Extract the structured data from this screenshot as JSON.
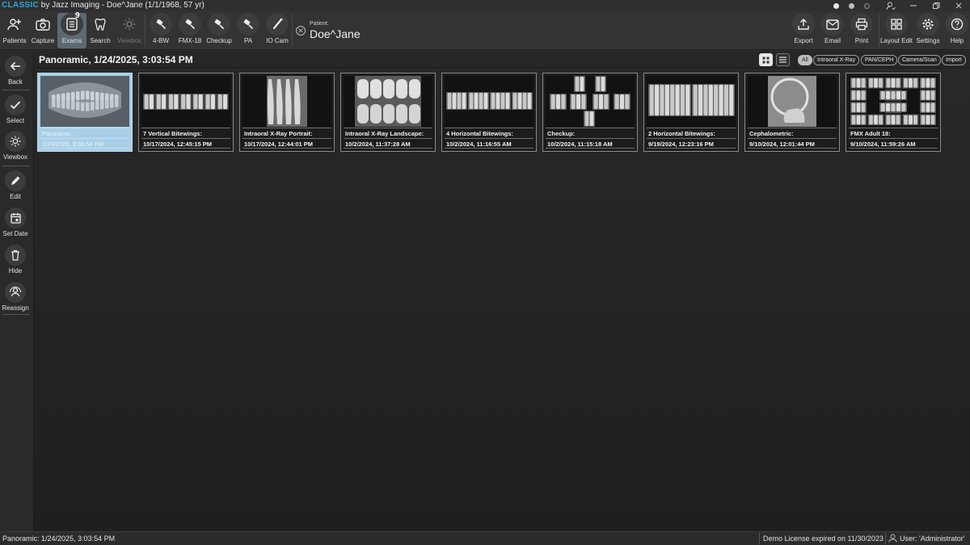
{
  "window": {
    "brand": "CLASSIC",
    "title_rest": " by Jazz Imaging - Doe^Jane (1/1/1968, 57 yr)"
  },
  "toolbar": {
    "patients": "Patients",
    "capture": "Capture",
    "exams": "Exams",
    "exams_badge": "9",
    "search": "Search",
    "viewbox": "Viewbox",
    "bw4": "4-BW",
    "fmx18": "FMX-18",
    "checkup": "Checkup",
    "pa": "PA",
    "iocam": "IO Cam",
    "export": "Export",
    "email": "Email",
    "print": "Print",
    "layout_edit": "Layout Edit",
    "settings": "Settings",
    "help": "Help"
  },
  "patient": {
    "label": "Patient:",
    "name": "Doe^Jane",
    "clear_glyph": "✕"
  },
  "sidebar": {
    "back": "Back",
    "select": "Select",
    "viewbox": "Viewbox",
    "edit": "Edit",
    "set_date": "Set Date",
    "hide": "Hide",
    "reassign": "Reassign"
  },
  "header": {
    "title": "Panoramic, 1/24/2025, 3:03:54 PM",
    "filters": [
      "All",
      "Intraoral X-Ray",
      "PAN/CEPH",
      "Camera/Scan",
      "Import"
    ]
  },
  "exams": [
    {
      "name": "Panoramic:",
      "date": "1/24/2025, 3:03:54 PM",
      "kind": "pan",
      "selected": true
    },
    {
      "name": "7 Vertical Bitewings:",
      "date": "10/17/2024, 12:45:15 PM",
      "kind": "strip7"
    },
    {
      "name": "Intraoral X-Ray Portrait:",
      "date": "10/17/2024, 12:44:01 PM",
      "kind": "portrait"
    },
    {
      "name": "Intraoral X-Ray Landscape:",
      "date": "10/2/2024, 11:37:28 AM",
      "kind": "landscape"
    },
    {
      "name": "4 Horizontal Bitewings:",
      "date": "10/2/2024, 11:16:55 AM",
      "kind": "bw4"
    },
    {
      "name": "Checkup:",
      "date": "10/2/2024, 11:15:18 AM",
      "kind": "checkup"
    },
    {
      "name": "2 Horizontal Bitewings:",
      "date": "9/19/2024, 12:23:16 PM",
      "kind": "bw2"
    },
    {
      "name": "Cephalometric:",
      "date": "9/10/2024, 12:01:44 PM",
      "kind": "ceph"
    },
    {
      "name": "FMX Adult 18:",
      "date": "9/10/2024, 11:59:26 AM",
      "kind": "fmx"
    }
  ],
  "status": {
    "left": "Panoramic: 1/24/2025, 3:03:54 PM",
    "license": "Demo License expired on 11/30/2023",
    "user": "User: 'Administrator'"
  },
  "colors": {
    "accent": "#2aa8e0",
    "selected_card": "#a9cfe8"
  }
}
